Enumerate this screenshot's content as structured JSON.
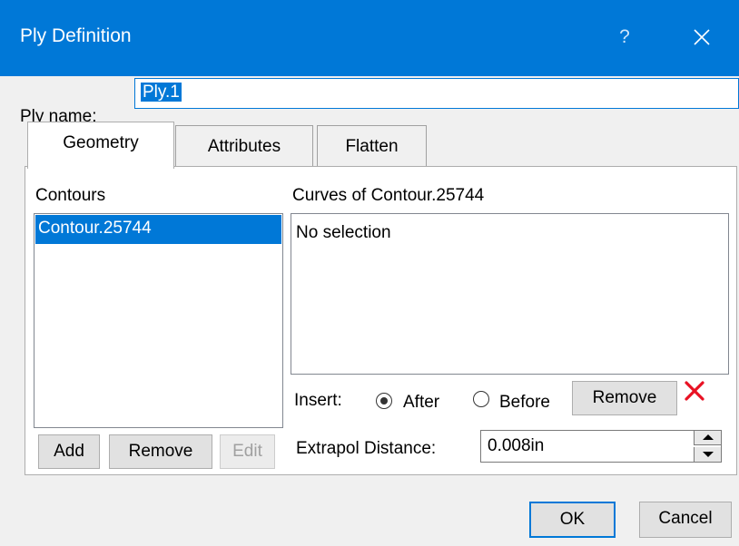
{
  "window": {
    "title": "Ply Definition",
    "help_glyph": "?"
  },
  "ply_name": {
    "label": "Ply name:",
    "value": "Ply.1"
  },
  "tabs": [
    {
      "label": "Geometry",
      "active": true
    },
    {
      "label": "Attributes",
      "active": false
    },
    {
      "label": "Flatten",
      "active": false
    }
  ],
  "geometry": {
    "contours_label": "Contours",
    "contours": [
      "Contour.25744"
    ],
    "curves_label": "Curves of Contour.25744",
    "curves_empty_text": "No selection",
    "insert": {
      "label": "Insert:",
      "options": [
        {
          "label": "After",
          "selected": true
        },
        {
          "label": "Before",
          "selected": false
        }
      ],
      "remove_label": "Remove"
    },
    "contour_buttons": {
      "add": "Add",
      "remove": "Remove",
      "edit": "Edit"
    },
    "extrapol": {
      "label": "Extrapol Distance:",
      "value": "0.008in"
    }
  },
  "footer": {
    "ok": "OK",
    "cancel": "Cancel"
  },
  "colors": {
    "accent": "#0078d7",
    "delete_red": "#e81123"
  }
}
